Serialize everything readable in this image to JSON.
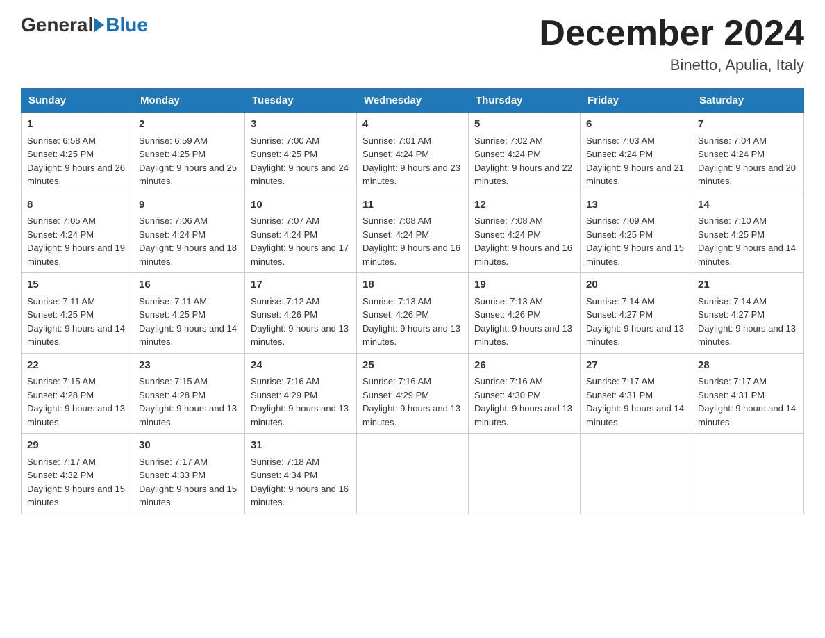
{
  "header": {
    "logo_general": "General",
    "logo_blue": "Blue",
    "month_year": "December 2024",
    "location": "Binetto, Apulia, Italy"
  },
  "days_of_week": [
    "Sunday",
    "Monday",
    "Tuesday",
    "Wednesday",
    "Thursday",
    "Friday",
    "Saturday"
  ],
  "weeks": [
    [
      {
        "day": "1",
        "sunrise": "Sunrise: 6:58 AM",
        "sunset": "Sunset: 4:25 PM",
        "daylight": "Daylight: 9 hours and 26 minutes."
      },
      {
        "day": "2",
        "sunrise": "Sunrise: 6:59 AM",
        "sunset": "Sunset: 4:25 PM",
        "daylight": "Daylight: 9 hours and 25 minutes."
      },
      {
        "day": "3",
        "sunrise": "Sunrise: 7:00 AM",
        "sunset": "Sunset: 4:25 PM",
        "daylight": "Daylight: 9 hours and 24 minutes."
      },
      {
        "day": "4",
        "sunrise": "Sunrise: 7:01 AM",
        "sunset": "Sunset: 4:24 PM",
        "daylight": "Daylight: 9 hours and 23 minutes."
      },
      {
        "day": "5",
        "sunrise": "Sunrise: 7:02 AM",
        "sunset": "Sunset: 4:24 PM",
        "daylight": "Daylight: 9 hours and 22 minutes."
      },
      {
        "day": "6",
        "sunrise": "Sunrise: 7:03 AM",
        "sunset": "Sunset: 4:24 PM",
        "daylight": "Daylight: 9 hours and 21 minutes."
      },
      {
        "day": "7",
        "sunrise": "Sunrise: 7:04 AM",
        "sunset": "Sunset: 4:24 PM",
        "daylight": "Daylight: 9 hours and 20 minutes."
      }
    ],
    [
      {
        "day": "8",
        "sunrise": "Sunrise: 7:05 AM",
        "sunset": "Sunset: 4:24 PM",
        "daylight": "Daylight: 9 hours and 19 minutes."
      },
      {
        "day": "9",
        "sunrise": "Sunrise: 7:06 AM",
        "sunset": "Sunset: 4:24 PM",
        "daylight": "Daylight: 9 hours and 18 minutes."
      },
      {
        "day": "10",
        "sunrise": "Sunrise: 7:07 AM",
        "sunset": "Sunset: 4:24 PM",
        "daylight": "Daylight: 9 hours and 17 minutes."
      },
      {
        "day": "11",
        "sunrise": "Sunrise: 7:08 AM",
        "sunset": "Sunset: 4:24 PM",
        "daylight": "Daylight: 9 hours and 16 minutes."
      },
      {
        "day": "12",
        "sunrise": "Sunrise: 7:08 AM",
        "sunset": "Sunset: 4:24 PM",
        "daylight": "Daylight: 9 hours and 16 minutes."
      },
      {
        "day": "13",
        "sunrise": "Sunrise: 7:09 AM",
        "sunset": "Sunset: 4:25 PM",
        "daylight": "Daylight: 9 hours and 15 minutes."
      },
      {
        "day": "14",
        "sunrise": "Sunrise: 7:10 AM",
        "sunset": "Sunset: 4:25 PM",
        "daylight": "Daylight: 9 hours and 14 minutes."
      }
    ],
    [
      {
        "day": "15",
        "sunrise": "Sunrise: 7:11 AM",
        "sunset": "Sunset: 4:25 PM",
        "daylight": "Daylight: 9 hours and 14 minutes."
      },
      {
        "day": "16",
        "sunrise": "Sunrise: 7:11 AM",
        "sunset": "Sunset: 4:25 PM",
        "daylight": "Daylight: 9 hours and 14 minutes."
      },
      {
        "day": "17",
        "sunrise": "Sunrise: 7:12 AM",
        "sunset": "Sunset: 4:26 PM",
        "daylight": "Daylight: 9 hours and 13 minutes."
      },
      {
        "day": "18",
        "sunrise": "Sunrise: 7:13 AM",
        "sunset": "Sunset: 4:26 PM",
        "daylight": "Daylight: 9 hours and 13 minutes."
      },
      {
        "day": "19",
        "sunrise": "Sunrise: 7:13 AM",
        "sunset": "Sunset: 4:26 PM",
        "daylight": "Daylight: 9 hours and 13 minutes."
      },
      {
        "day": "20",
        "sunrise": "Sunrise: 7:14 AM",
        "sunset": "Sunset: 4:27 PM",
        "daylight": "Daylight: 9 hours and 13 minutes."
      },
      {
        "day": "21",
        "sunrise": "Sunrise: 7:14 AM",
        "sunset": "Sunset: 4:27 PM",
        "daylight": "Daylight: 9 hours and 13 minutes."
      }
    ],
    [
      {
        "day": "22",
        "sunrise": "Sunrise: 7:15 AM",
        "sunset": "Sunset: 4:28 PM",
        "daylight": "Daylight: 9 hours and 13 minutes."
      },
      {
        "day": "23",
        "sunrise": "Sunrise: 7:15 AM",
        "sunset": "Sunset: 4:28 PM",
        "daylight": "Daylight: 9 hours and 13 minutes."
      },
      {
        "day": "24",
        "sunrise": "Sunrise: 7:16 AM",
        "sunset": "Sunset: 4:29 PM",
        "daylight": "Daylight: 9 hours and 13 minutes."
      },
      {
        "day": "25",
        "sunrise": "Sunrise: 7:16 AM",
        "sunset": "Sunset: 4:29 PM",
        "daylight": "Daylight: 9 hours and 13 minutes."
      },
      {
        "day": "26",
        "sunrise": "Sunrise: 7:16 AM",
        "sunset": "Sunset: 4:30 PM",
        "daylight": "Daylight: 9 hours and 13 minutes."
      },
      {
        "day": "27",
        "sunrise": "Sunrise: 7:17 AM",
        "sunset": "Sunset: 4:31 PM",
        "daylight": "Daylight: 9 hours and 14 minutes."
      },
      {
        "day": "28",
        "sunrise": "Sunrise: 7:17 AM",
        "sunset": "Sunset: 4:31 PM",
        "daylight": "Daylight: 9 hours and 14 minutes."
      }
    ],
    [
      {
        "day": "29",
        "sunrise": "Sunrise: 7:17 AM",
        "sunset": "Sunset: 4:32 PM",
        "daylight": "Daylight: 9 hours and 15 minutes."
      },
      {
        "day": "30",
        "sunrise": "Sunrise: 7:17 AM",
        "sunset": "Sunset: 4:33 PM",
        "daylight": "Daylight: 9 hours and 15 minutes."
      },
      {
        "day": "31",
        "sunrise": "Sunrise: 7:18 AM",
        "sunset": "Sunset: 4:34 PM",
        "daylight": "Daylight: 9 hours and 16 minutes."
      },
      {
        "day": "",
        "sunrise": "",
        "sunset": "",
        "daylight": ""
      },
      {
        "day": "",
        "sunrise": "",
        "sunset": "",
        "daylight": ""
      },
      {
        "day": "",
        "sunrise": "",
        "sunset": "",
        "daylight": ""
      },
      {
        "day": "",
        "sunrise": "",
        "sunset": "",
        "daylight": ""
      }
    ]
  ]
}
